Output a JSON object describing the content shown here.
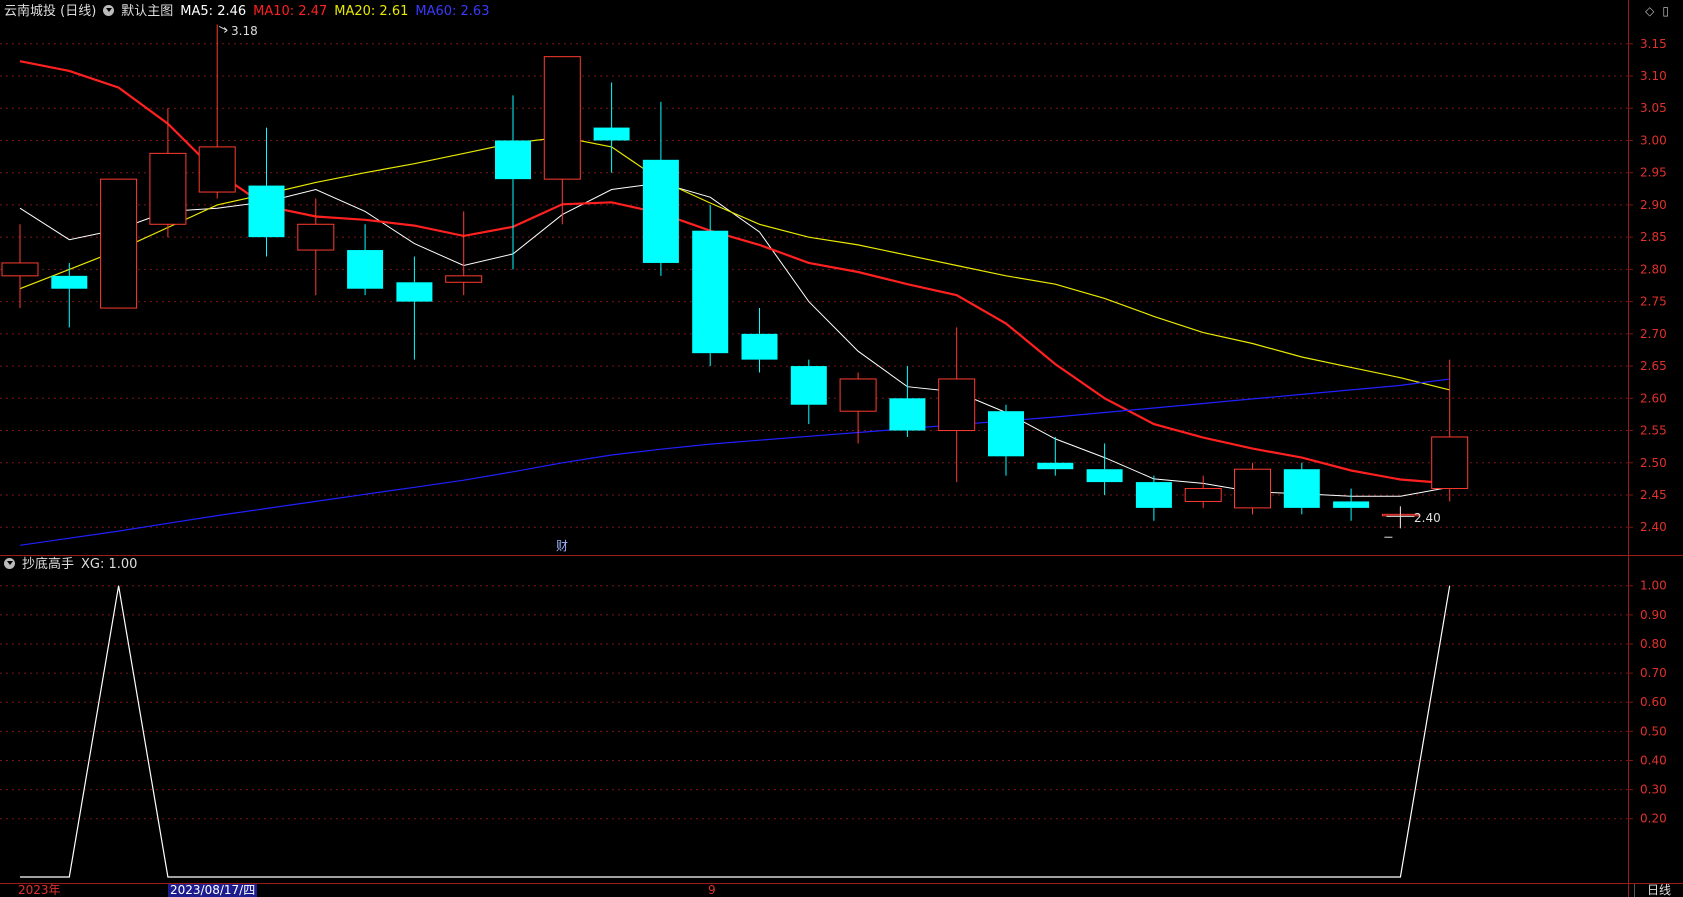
{
  "header": {
    "stock_name": "云南城投 (日线)",
    "template_name": "默认主图",
    "ma5": "MA5: 2.46",
    "ma10": "MA10: 2.47",
    "ma20": "MA20: 2.61",
    "ma60": "MA60: 2.63"
  },
  "corner_icons": [
    "diamond-icon",
    "window-icon"
  ],
  "colors": {
    "background": "#000000",
    "grid": "#7a1616",
    "up": "#ff3b30",
    "down": "#00ffff",
    "ma5": "#ffffff",
    "ma10": "#ff2020",
    "ma20": "#e8e800",
    "ma60": "#2020ff",
    "axis_text": "#e0312c"
  },
  "chart_data": [
    {
      "type": "candlestick",
      "title": "云南城投 (日线)",
      "y_ticks": [
        "3.15",
        "3.10",
        "3.05",
        "3.00",
        "2.95",
        "2.90",
        "2.85",
        "2.80",
        "2.75",
        "2.70",
        "2.65",
        "2.60",
        "2.55",
        "2.50",
        "2.45",
        "2.40"
      ],
      "ylim": [
        2.36,
        3.19
      ],
      "grid": true,
      "candles": [
        {
          "o": 2.79,
          "h": 2.87,
          "l": 2.74,
          "c": 2.81
        },
        {
          "o": 2.79,
          "h": 2.81,
          "l": 2.71,
          "c": 2.77
        },
        {
          "o": 2.74,
          "h": 2.94,
          "l": 2.74,
          "c": 2.94
        },
        {
          "o": 2.87,
          "h": 3.05,
          "l": 2.85,
          "c": 2.98
        },
        {
          "o": 2.92,
          "h": 3.18,
          "l": 2.91,
          "c": 2.99
        },
        {
          "o": 2.93,
          "h": 3.02,
          "l": 2.82,
          "c": 2.85
        },
        {
          "o": 2.83,
          "h": 2.91,
          "l": 2.76,
          "c": 2.87
        },
        {
          "o": 2.83,
          "h": 2.87,
          "l": 2.76,
          "c": 2.77
        },
        {
          "o": 2.78,
          "h": 2.82,
          "l": 2.66,
          "c": 2.75
        },
        {
          "o": 2.78,
          "h": 2.89,
          "l": 2.76,
          "c": 2.79
        },
        {
          "o": 3.0,
          "h": 3.07,
          "l": 2.8,
          "c": 2.94
        },
        {
          "o": 2.94,
          "h": 3.13,
          "l": 2.87,
          "c": 3.13
        },
        {
          "o": 3.02,
          "h": 3.09,
          "l": 2.95,
          "c": 3.0
        },
        {
          "o": 2.97,
          "h": 3.06,
          "l": 2.79,
          "c": 2.81
        },
        {
          "o": 2.86,
          "h": 2.9,
          "l": 2.65,
          "c": 2.67
        },
        {
          "o": 2.7,
          "h": 2.74,
          "l": 2.64,
          "c": 2.66
        },
        {
          "o": 2.65,
          "h": 2.66,
          "l": 2.56,
          "c": 2.59
        },
        {
          "o": 2.58,
          "h": 2.64,
          "l": 2.53,
          "c": 2.63
        },
        {
          "o": 2.6,
          "h": 2.65,
          "l": 2.54,
          "c": 2.55
        },
        {
          "o": 2.55,
          "h": 2.71,
          "l": 2.47,
          "c": 2.63
        },
        {
          "o": 2.58,
          "h": 2.59,
          "l": 2.48,
          "c": 2.51
        },
        {
          "o": 2.5,
          "h": 2.54,
          "l": 2.48,
          "c": 2.49
        },
        {
          "o": 2.49,
          "h": 2.53,
          "l": 2.45,
          "c": 2.47
        },
        {
          "o": 2.47,
          "h": 2.48,
          "l": 2.41,
          "c": 2.43
        },
        {
          "o": 2.44,
          "h": 2.48,
          "l": 2.43,
          "c": 2.46
        },
        {
          "o": 2.43,
          "h": 2.5,
          "l": 2.42,
          "c": 2.49
        },
        {
          "o": 2.49,
          "h": 2.5,
          "l": 2.42,
          "c": 2.43
        },
        {
          "o": 2.44,
          "h": 2.46,
          "l": 2.41,
          "c": 2.43
        },
        {
          "o": 2.42,
          "h": 2.43,
          "l": 2.4,
          "c": 2.42
        },
        {
          "o": 2.46,
          "h": 2.66,
          "l": 2.44,
          "c": 2.54
        }
      ],
      "series": [
        {
          "name": "MA5",
          "values": [
            2.895,
            2.846,
            2.862,
            2.89,
            2.895,
            2.905,
            2.924,
            2.89,
            2.84,
            2.806,
            2.824,
            2.885,
            2.924,
            2.934,
            2.912,
            2.858,
            2.75,
            2.673,
            2.618,
            2.61,
            2.578,
            2.537,
            2.508,
            2.475,
            2.468,
            2.455,
            2.452,
            2.448,
            2.448,
            2.462
          ]
        },
        {
          "name": "MA10",
          "values": [
            3.123,
            3.108,
            3.082,
            3.026,
            2.95,
            2.898,
            2.882,
            2.877,
            2.868,
            2.852,
            2.866,
            2.901,
            2.904,
            2.887,
            2.86,
            2.838,
            2.81,
            2.796,
            2.777,
            2.76,
            2.716,
            2.653,
            2.6,
            2.56,
            2.539,
            2.522,
            2.508,
            2.488,
            2.474,
            2.468
          ]
        },
        {
          "name": "MA20",
          "values": [
            2.77,
            2.8,
            2.83,
            2.865,
            2.9,
            2.917,
            2.935,
            2.95,
            2.964,
            2.98,
            2.996,
            3.005,
            2.99,
            2.938,
            2.903,
            2.87,
            2.85,
            2.838,
            2.822,
            2.806,
            2.79,
            2.777,
            2.755,
            2.727,
            2.702,
            2.685,
            2.664,
            2.648,
            2.632,
            2.613
          ]
        },
        {
          "name": "MA60",
          "values": [
            2.372,
            2.383,
            2.394,
            2.406,
            2.418,
            2.429,
            2.44,
            2.451,
            2.462,
            2.473,
            2.486,
            2.5,
            2.512,
            2.521,
            2.529,
            2.535,
            2.541,
            2.547,
            2.553,
            2.559,
            2.565,
            2.571,
            2.578,
            2.585,
            2.592,
            2.599,
            2.606,
            2.613,
            2.62,
            2.63
          ]
        }
      ],
      "annotations": {
        "high_label": "3.18",
        "low_label": "2.40",
        "event_marker": "财"
      }
    },
    {
      "type": "line",
      "title": "抄底高手 XG: 1.00",
      "y_ticks": [
        "1.00",
        "0.90",
        "0.80",
        "0.70",
        "0.60",
        "0.50",
        "0.40",
        "0.30",
        "0.20"
      ],
      "ylim": [
        0,
        1.03
      ],
      "series": [
        {
          "name": "XG",
          "values": [
            0,
            0,
            1,
            0,
            0,
            0,
            0,
            0,
            0,
            0,
            0,
            0,
            0,
            0,
            0,
            0,
            0,
            0,
            0,
            0,
            0,
            0,
            0,
            0,
            0,
            0,
            0,
            0,
            0,
            1
          ]
        }
      ]
    }
  ],
  "indicator_panel": {
    "label": "抄底高手",
    "value": "XG: 1.00"
  },
  "date_bar": {
    "year": "2023年",
    "selected_date": "2023/08/17/四",
    "month": "9",
    "period_tab": "日线"
  }
}
